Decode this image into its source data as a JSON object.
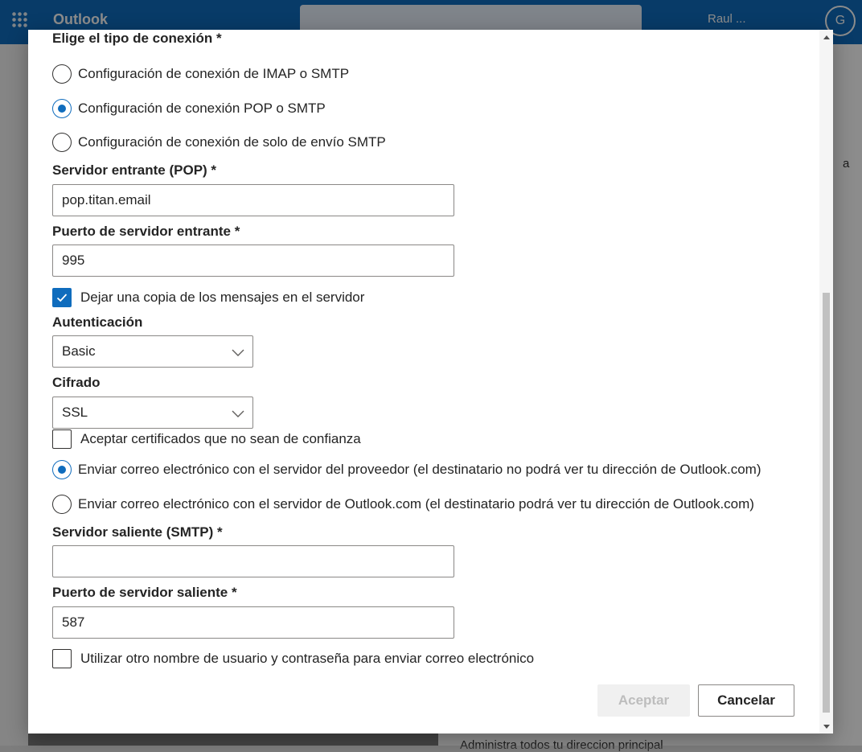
{
  "background": {
    "brand": "Outlook",
    "user_name": "Raul ...",
    "avatar_initial": "G",
    "main_text": "Administra todos tu direccion principal",
    "side_letter": "a"
  },
  "dialog": {
    "connection_type": {
      "label": "Elige el tipo de conexión *",
      "options": [
        {
          "label": "Configuración de conexión de IMAP o SMTP",
          "checked": false
        },
        {
          "label": "Configuración de conexión POP o SMTP",
          "checked": true
        },
        {
          "label": "Configuración de conexión de solo de envío SMTP",
          "checked": false
        }
      ]
    },
    "incoming_server": {
      "label": "Servidor entrante (POP) *",
      "value": "pop.titan.email"
    },
    "incoming_port": {
      "label": "Puerto de servidor entrante *",
      "value": "995"
    },
    "leave_copy": {
      "label": "Dejar una copia de los mensajes en el servidor",
      "checked": true
    },
    "authentication": {
      "label": "Autenticación",
      "value": "Basic"
    },
    "encryption": {
      "label": "Cifrado",
      "value": "SSL"
    },
    "accept_certs": {
      "label": "Aceptar certificados que no sean de confianza",
      "checked": false
    },
    "send_options": [
      {
        "label": "Enviar correo electrónico con el servidor del proveedor (el destinatario no podrá ver tu dirección de Outlook.com)",
        "checked": true
      },
      {
        "label": "Enviar correo electrónico con el servidor de Outlook.com (el destinatario podrá ver tu dirección de Outlook.com)",
        "checked": false
      }
    ],
    "outgoing_server": {
      "label": "Servidor saliente (SMTP) *",
      "value": ""
    },
    "outgoing_port": {
      "label": "Puerto de servidor saliente *",
      "value": "587"
    },
    "other_credentials": {
      "label": "Utilizar otro nombre de usuario y contraseña para enviar correo electrónico",
      "checked": false
    },
    "buttons": {
      "accept": "Aceptar",
      "cancel": "Cancelar"
    }
  },
  "colors": {
    "accent": "#0f6cbd",
    "topbar": "#0f6cbd"
  }
}
